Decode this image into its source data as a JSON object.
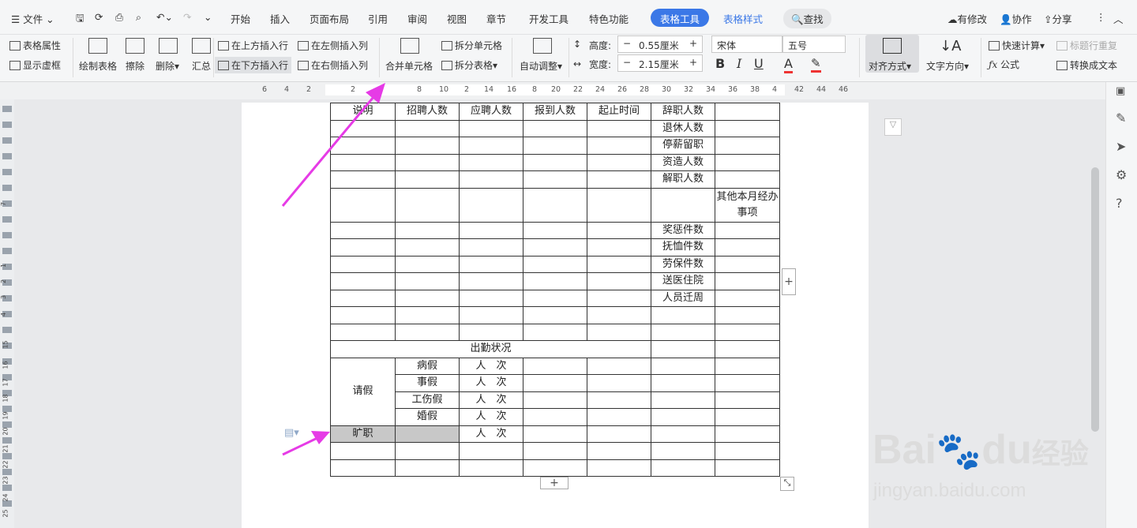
{
  "menu": {
    "file": "文件",
    "tabs": [
      "开始",
      "插入",
      "页面布局",
      "引用",
      "审阅",
      "视图",
      "章节",
      "开发工具",
      "特色功能"
    ],
    "active_tab": "表格工具",
    "tab2": "表格样式",
    "search": "查找",
    "right": [
      "有修改",
      "协作",
      "分享"
    ]
  },
  "toolbar": {
    "table_props": "表格属性",
    "show_grid": "显示虚框",
    "draw_table": "绘制表格",
    "erase": "擦除",
    "delete": "删除",
    "summary": "汇总",
    "insert_above": "在上方插入行",
    "insert_below": "在下方插入行",
    "insert_left": "在左侧插入列",
    "insert_right": "在右侧插入列",
    "merge": "合并单元格",
    "split_cell": "拆分单元格",
    "split_table": "拆分表格",
    "auto_adjust": "自动调整",
    "height_label": "高度:",
    "height_value": "0.55厘米",
    "width_label": "宽度:",
    "width_value": "2.15厘米",
    "font": "宋体",
    "size": "五号",
    "bold": "B",
    "italic": "I",
    "underline": "U",
    "fontcolor": "A",
    "align": "对齐方式",
    "text_dir": "文字方向",
    "quick_calc": "快速计算",
    "repeat_header": "标题行重复",
    "formula": "公式",
    "to_text": "转换成文本"
  },
  "ruler": [
    "6",
    "4",
    "2",
    "2",
    "8",
    "10",
    "2",
    "14",
    "16",
    "8",
    "20",
    "22",
    "24",
    "26",
    "28",
    "30",
    "32",
    "34",
    "36",
    "38",
    "4",
    "42",
    "44",
    "46"
  ],
  "left_ruler": [
    "7",
    "1",
    "2",
    "3",
    "4",
    "15",
    "16",
    "17",
    "18",
    "19",
    "20",
    "21",
    "22",
    "23",
    "24",
    "25"
  ],
  "table": {
    "header": [
      "说明",
      "招聘人数",
      "应聘人数",
      "报到人数",
      "起止时间",
      "辞职人数",
      ""
    ],
    "col6": [
      "退休人数",
      "停薪留职",
      "资造人数",
      "解职人数",
      "",
      "奖惩件数",
      "抚恤件数",
      "劳保件数",
      "送医住院",
      "人员迁周"
    ],
    "other": "其他本月经办事项",
    "attendance": "出勤状况",
    "leave": "请假",
    "leave_types": [
      "病假",
      "事假",
      "工伤假",
      "婚假"
    ],
    "per": "人　次",
    "absent": "旷职"
  },
  "watermark": {
    "brand": "Bai",
    "brand2": "du",
    "site": "jingyan.baidu.com",
    "cn": "经验"
  }
}
